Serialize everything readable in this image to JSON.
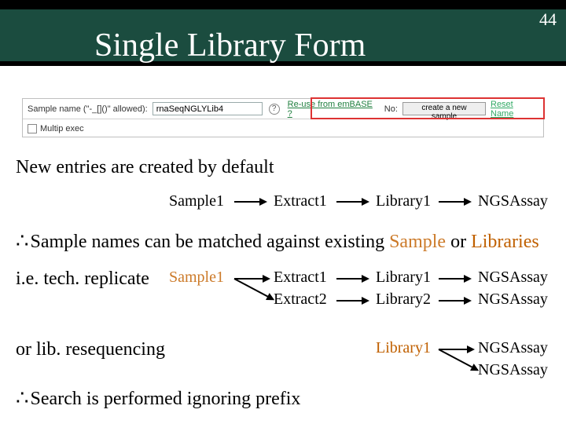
{
  "page_number": "44",
  "title": "Single Library Form",
  "form": {
    "sample_label": "Sample name (\"-_[]()\" allowed):",
    "sample_value": "rnaSeqNGLYLib4",
    "reuse_link": "Re-use from emBASE ?",
    "no_text": "No:",
    "create_btn": "create a new sample",
    "reset_link": "Reset Name",
    "multip_label": "Multip exec"
  },
  "text": {
    "line1": "New entries are created by default",
    "sample1": "Sample1",
    "extract1": "Extract1",
    "extract2": "Extract2",
    "library1": "Library1",
    "library2": "Library2",
    "ngsassay": "NGSAssay",
    "match_prefix": "Sample names can be matched against existing ",
    "match_sample": "Sample",
    "match_or": " or ",
    "match_libs": "Libraries",
    "tech_rep": "i.e. tech. replicate",
    "lib_reseq": "or lib. resequencing",
    "search_ignore": "Search is performed ignoring prefix"
  }
}
